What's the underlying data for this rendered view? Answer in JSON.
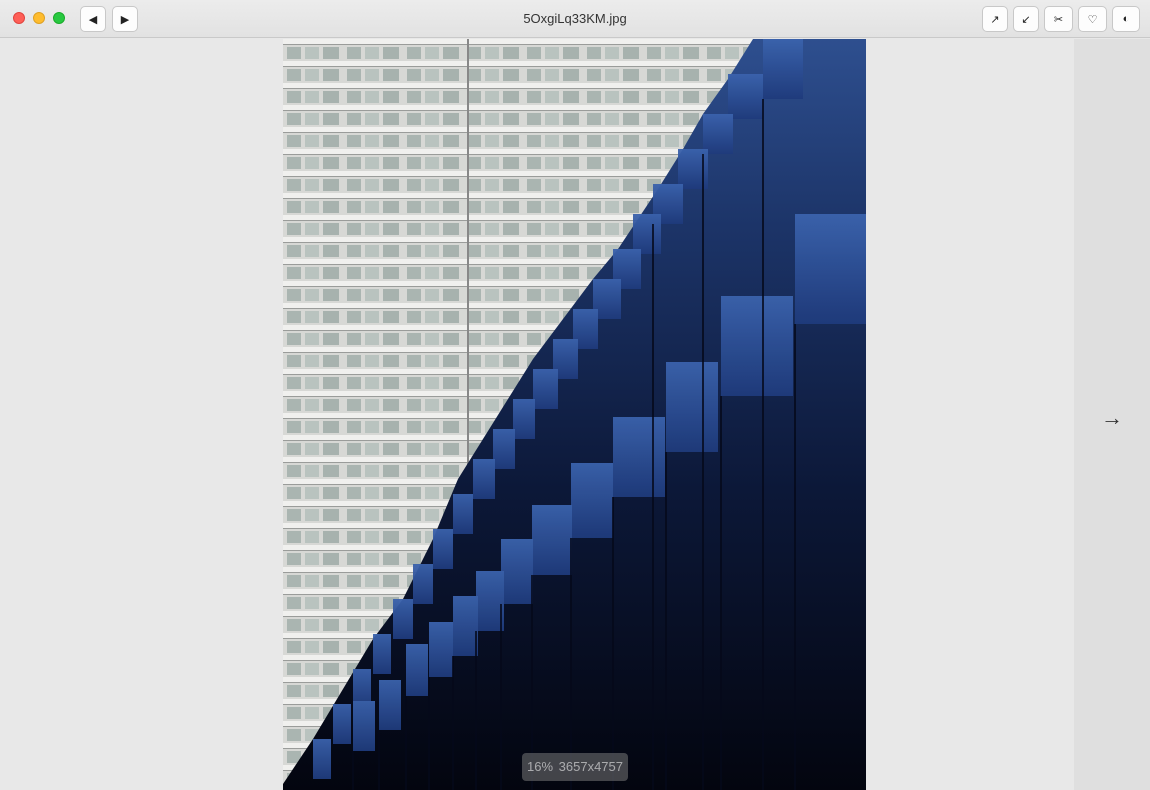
{
  "window": {
    "title": "5OxgiLq33KM.jpg"
  },
  "toolbar": {
    "prev_icon": "◀",
    "next_icon": "▶",
    "expand_icon": "↗",
    "shrink_icon": "↙",
    "crop_icon": "✂",
    "favorite_icon": "♡",
    "contrast_icon": "◐"
  },
  "viewer": {
    "next_arrow": "→",
    "zoom": "16%",
    "dimensions": "3657x4757"
  },
  "colors": {
    "close": "#fe5f57",
    "minimize": "#febc2e",
    "maximize": "#28c840",
    "panel": "#e8e8e8"
  }
}
